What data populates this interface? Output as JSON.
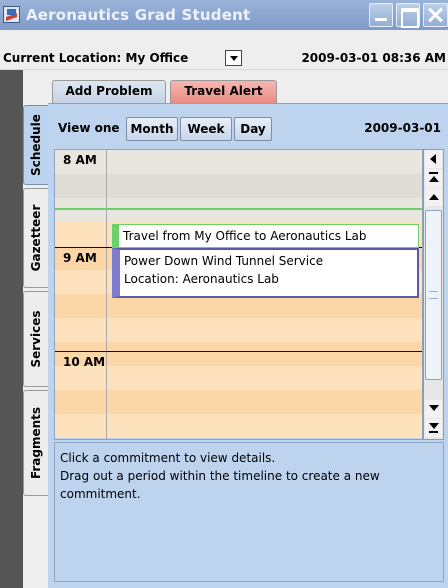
{
  "window": {
    "title": "Aeronautics Grad Student",
    "app_icon": "application-icon",
    "controls": [
      "minimize-icon",
      "maximize-icon",
      "close-icon"
    ]
  },
  "location_bar": {
    "label": "Current Location: My Office",
    "datetime": "2009-03-01 08:36 AM"
  },
  "top_tabs": [
    {
      "label": "Add Problem"
    },
    {
      "label": "Travel Alert",
      "color": "#EC8E87"
    }
  ],
  "side_tabs": [
    {
      "label": "Schedule",
      "selected": true
    },
    {
      "label": "Gazetteer"
    },
    {
      "label": "Services"
    },
    {
      "label": "Fragments"
    }
  ],
  "view_bar": {
    "label": "View one",
    "buttons": [
      {
        "label": "Month"
      },
      {
        "label": "Week"
      },
      {
        "label": "Day"
      }
    ],
    "date": "2009-03-01"
  },
  "timeline": {
    "hours": [
      "8 AM",
      "9 AM",
      "10 AM"
    ],
    "events": [
      {
        "title": "Travel from My Office to Aeronautics Lab",
        "color": "#6BD16B"
      },
      {
        "title": "Power Down Wind Tunnel Service",
        "location": "Location: Aeronautics Lab",
        "color": "#7F7BD0"
      }
    ]
  },
  "details": {
    "line1": "Click a commitment to view details.",
    "line2": "Drag out a period within the timeline to create a new",
    "line3": "commitment."
  },
  "colors": {
    "panel_bg": "#BED4EE",
    "titlebar": "#8AA6D0"
  }
}
